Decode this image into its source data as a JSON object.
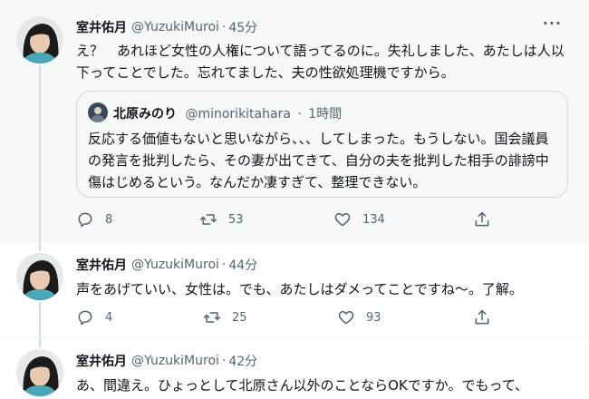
{
  "colors": {
    "text_primary": "#0f1419",
    "text_secondary": "#536471",
    "border": "#cfd9de",
    "highlight_bg": "#f7f9f9"
  },
  "tweets": [
    {
      "name": "室井佑月",
      "handle": "@YuzukiMuroi",
      "separator": "·",
      "time": "45分",
      "more_icon": "more-horizontal-icon",
      "text": "え？　あれほど女性の人権について語ってるのに。失礼しました、あたしは人以下ってことでした。忘れてました、夫の性欲処理機ですから。",
      "quote": {
        "name": "北原みのり",
        "handle": "@minorikitahara",
        "separator": "·",
        "time": "1時間",
        "text": "反応する価値もないと思いながら、、、してしまった。もうしない。国会議員の発言を批判したら、その妻が出てきて、自分の夫を批判した相手の誹謗中傷はじめるという。なんだか凄すぎて、整理できない。"
      },
      "stats": {
        "replies": "8",
        "retweets": "53",
        "likes": "134"
      }
    },
    {
      "name": "室井佑月",
      "handle": "@YuzukiMuroi",
      "separator": "·",
      "time": "44分",
      "text": "声をあげていい、女性は。でも、あたしはダメってことですね〜。了解。",
      "stats": {
        "replies": "4",
        "retweets": "25",
        "likes": "93"
      }
    },
    {
      "name": "室井佑月",
      "handle": "@YuzukiMuroi",
      "separator": "·",
      "time": "42分",
      "text": "あ、間違え。ひょっとして北原さん以外のことならOKですか。でもって、"
    }
  ]
}
